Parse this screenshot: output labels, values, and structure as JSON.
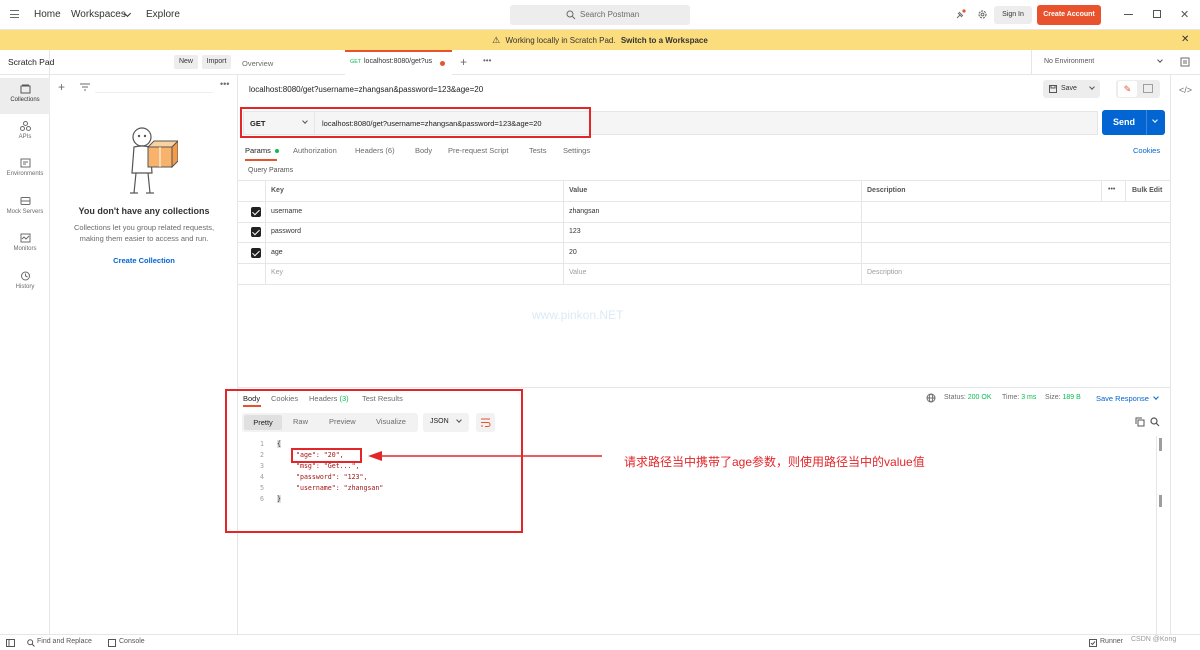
{
  "nav": {
    "home": "Home",
    "workspaces": "Workspaces",
    "explore": "Explore",
    "search_placeholder": "Search Postman",
    "sign_in": "Sign In",
    "create_account": "Create Account"
  },
  "banner": {
    "text": "Working locally in Scratch Pad.",
    "link": "Switch to a Workspace"
  },
  "scratch": {
    "title": "Scratch Pad",
    "new": "New",
    "import": "Import"
  },
  "sidebar": {
    "items": [
      {
        "label": "Collections",
        "icon": "collections-icon"
      },
      {
        "label": "APIs",
        "icon": "apis-icon"
      },
      {
        "label": "Environments",
        "icon": "environments-icon"
      },
      {
        "label": "Mock Servers",
        "icon": "mock-servers-icon"
      },
      {
        "label": "Monitors",
        "icon": "monitors-icon"
      },
      {
        "label": "History",
        "icon": "history-icon"
      }
    ]
  },
  "collections": {
    "empty_title": "You don't have any collections",
    "empty_line1": "Collections let you group related requests,",
    "empty_line2": "making them easier to access and run.",
    "create": "Create Collection"
  },
  "tabs": {
    "overview": "Overview",
    "method_badge": "GET",
    "active": "localhost:8080/get?us",
    "environment": "No Environment"
  },
  "request": {
    "title": "localhost:8080/get?username=zhangsan&password=123&age=20",
    "save": "Save",
    "method": "GET",
    "url": "localhost:8080/get?username=zhangsan&password=123&age=20",
    "send": "Send",
    "tabs": [
      "Params",
      "Authorization",
      "Headers (6)",
      "Body",
      "Pre-request Script",
      "Tests",
      "Settings"
    ],
    "cookies": "Cookies",
    "query_params_label": "Query Params",
    "columns": {
      "key": "Key",
      "value": "Value",
      "description": "Description",
      "bulk_edit": "Bulk Edit"
    },
    "params": [
      {
        "key": "username",
        "value": "zhangsan"
      },
      {
        "key": "password",
        "value": "123"
      },
      {
        "key": "age",
        "value": "20"
      }
    ],
    "placeholder": {
      "key": "Key",
      "value": "Value",
      "description": "Description"
    }
  },
  "watermark": "www.pinkon.NET",
  "response": {
    "tabs": {
      "body": "Body",
      "cookies": "Cookies",
      "headers": "Headers",
      "headers_count": "(3)",
      "tests": "Test Results"
    },
    "status": "Status:",
    "status_val": "200 OK",
    "time": "Time:",
    "time_val": "3 ms",
    "size": "Size:",
    "size_val": "189 B",
    "save_response": "Save Response",
    "views": [
      "Pretty",
      "Raw",
      "Preview",
      "Visualize"
    ],
    "format": "JSON",
    "lines": [
      {
        "n": "1",
        "text": "{"
      },
      {
        "n": "2",
        "text": "\"age\": \"20\","
      },
      {
        "n": "3",
        "text": "\"msg\": \"Get...\","
      },
      {
        "n": "4",
        "text": "\"password\": \"123\","
      },
      {
        "n": "5",
        "text": "\"username\": \"zhangsan\""
      },
      {
        "n": "6",
        "text": "}"
      }
    ]
  },
  "annotation": "请求路径当中携带了age参数，则使用路径当中的value值",
  "footer": {
    "find": "Find and Replace",
    "console": "Console",
    "runner": "Runner",
    "credit": "CSDN @Kong"
  },
  "colors": {
    "accent": "#e8532d",
    "send": "#0265d2",
    "link": "#0265d2",
    "annotation": "#e3262a",
    "banner": "#fbdd7d"
  }
}
